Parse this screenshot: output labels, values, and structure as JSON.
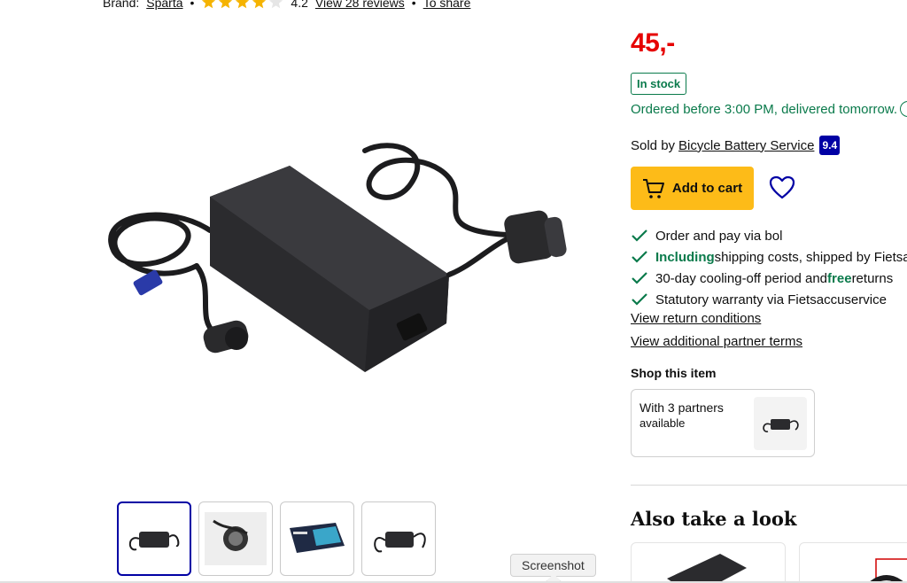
{
  "meta": {
    "brand_label": "Brand:",
    "brand_name": "Sparta",
    "separator": "•",
    "rating": "4.2",
    "reviews_link": "View 28 reviews",
    "share_link": "To share",
    "stars_filled": 4,
    "stars_total": 5
  },
  "price": "45,-",
  "stock": "In stock",
  "delivery": "Ordered before 3:00 PM, delivered tomorrow.",
  "seller": {
    "prefix": "Sold by",
    "name": "Bicycle Battery Service",
    "rating": "9.4"
  },
  "actions": {
    "add_to_cart": "Add to cart",
    "wishlist_icon": "heart-icon",
    "cart_icon": "cart-icon"
  },
  "usps": [
    {
      "pre": "",
      "bold": "",
      "post": "Order and pay via bol"
    },
    {
      "pre": "",
      "bold": "Including",
      "post": " shipping costs, shipped by Fietsa"
    },
    {
      "pre": "30-day cooling-off period and ",
      "bold": "free",
      "post": " returns"
    },
    {
      "pre": "",
      "bold": "",
      "post": "Statutory warranty via Fietsaccuservice"
    }
  ],
  "links": {
    "return_conditions": "View return conditions",
    "partner_terms": "View additional partner terms"
  },
  "shop": {
    "title": "Shop this item",
    "partners": "With 3 partners",
    "available": "available"
  },
  "also": {
    "title": "Also take a look"
  },
  "tooltip": "Screenshot",
  "colors": {
    "price": "#e60000",
    "green": "#0a7a4b",
    "brand_blue": "#0000a4",
    "cart_yellow": "#fdbb18",
    "star": "#f5b301"
  }
}
